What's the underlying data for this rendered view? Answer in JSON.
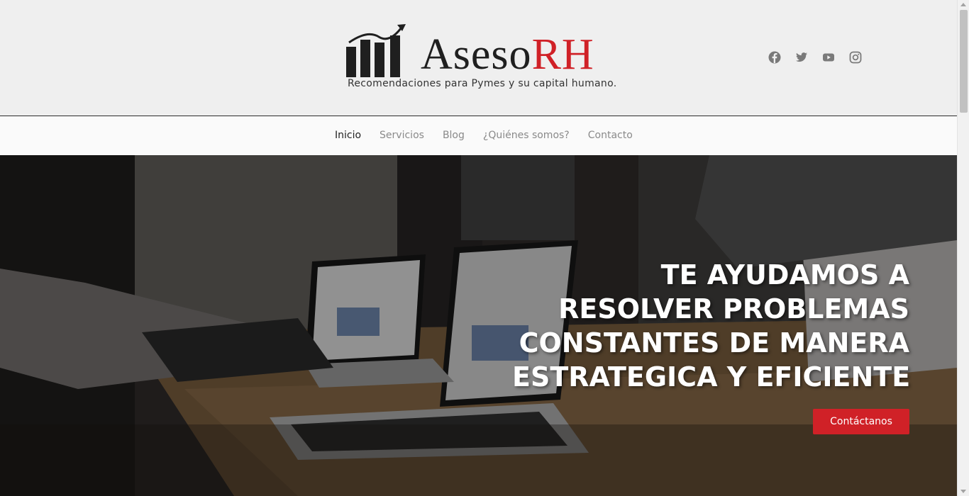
{
  "brand": {
    "name_dark": "Aseso",
    "name_accent": "RH",
    "tagline": "Recomendaciones para Pymes y su capital humano.",
    "accent_color": "#d02127"
  },
  "social": [
    {
      "icon": "facebook-icon",
      "label": "Facebook"
    },
    {
      "icon": "twitter-icon",
      "label": "Twitter"
    },
    {
      "icon": "youtube-icon",
      "label": "YouTube"
    },
    {
      "icon": "instagram-icon",
      "label": "Instagram"
    }
  ],
  "nav": {
    "items": [
      {
        "label": "Inicio",
        "active": true
      },
      {
        "label": "Servicios",
        "active": false
      },
      {
        "label": "Blog",
        "active": false
      },
      {
        "label": "¿Quiénes somos?",
        "active": false
      },
      {
        "label": "Contacto",
        "active": false
      }
    ]
  },
  "hero": {
    "title_lines": [
      "TE AYUDAMOS A",
      "RESOLVER PROBLEMAS",
      "CONSTANTES DE MANERA",
      "ESTRATEGICA Y EFICIENTE"
    ],
    "cta_label": "Contáctanos"
  }
}
